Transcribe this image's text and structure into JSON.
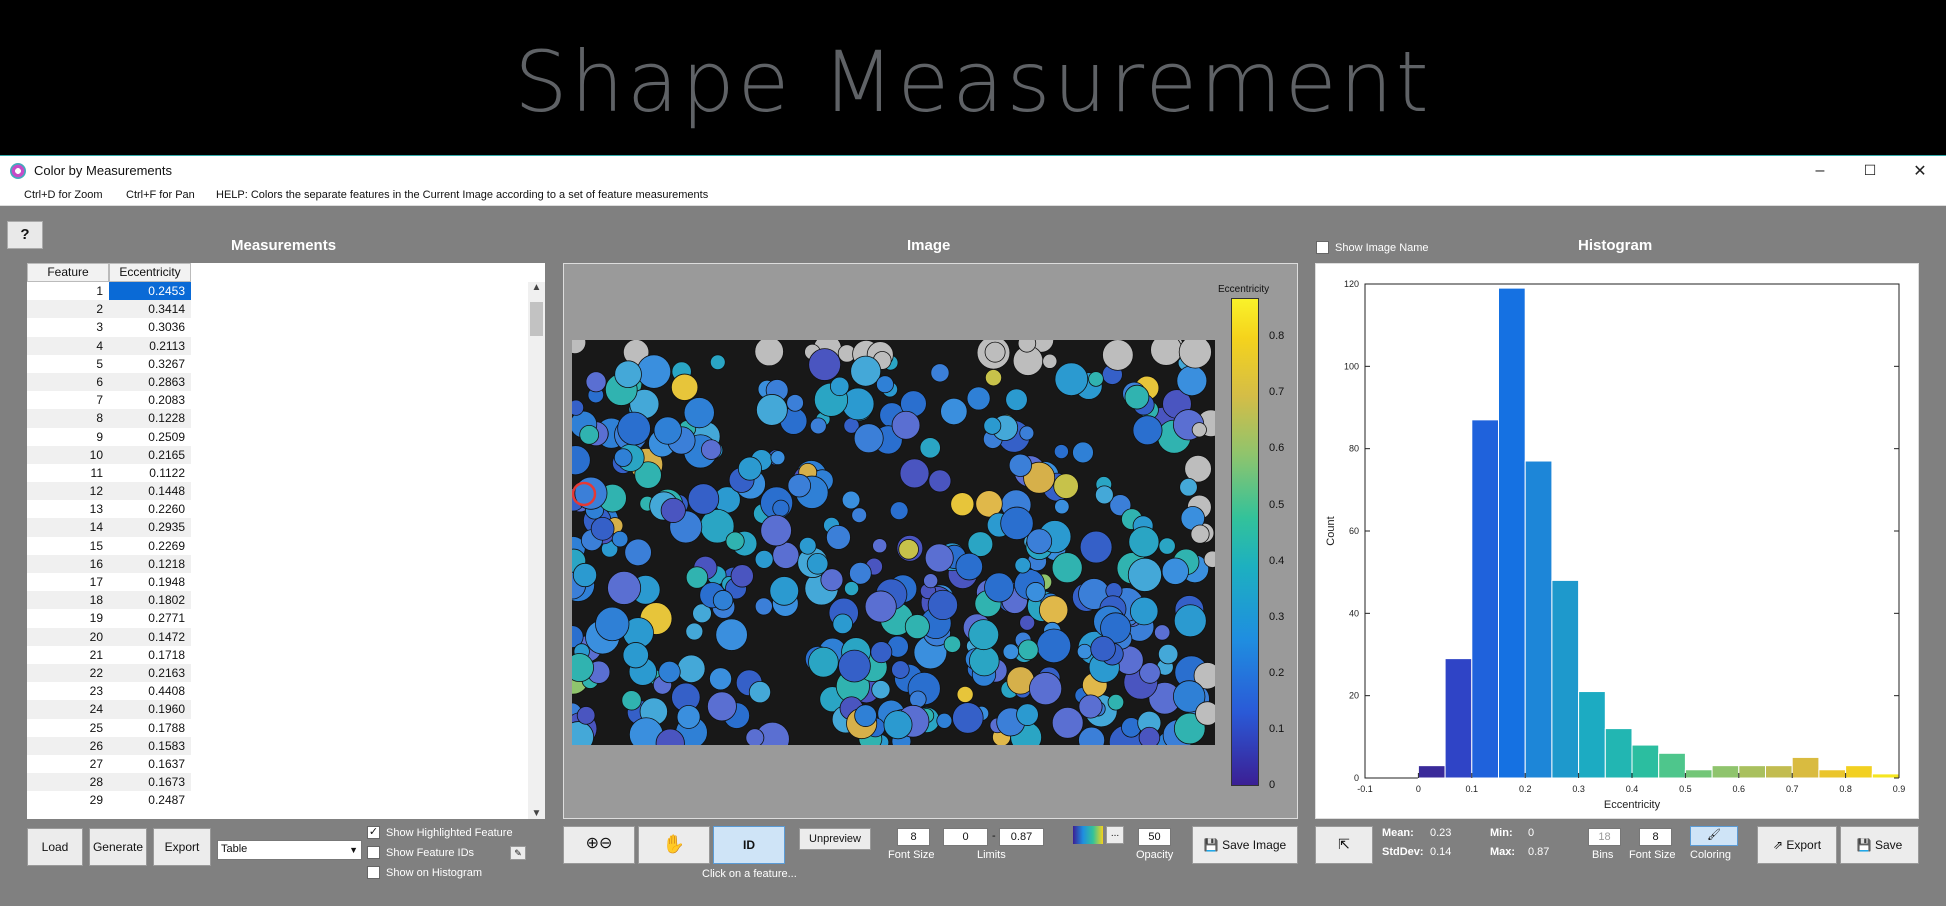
{
  "banner": {
    "title": "Shape Measurement"
  },
  "window": {
    "title": "Color by Measurements",
    "controls": {
      "minimize": "–",
      "maximize": "☐",
      "close": "✕"
    }
  },
  "menu": {
    "zoom": "Ctrl+D for Zoom",
    "pan": "Ctrl+F for Pan",
    "help": "HELP:  Colors the separate features in the Current Image according to a set of feature measurements"
  },
  "help_button": "?",
  "measurements": {
    "title": "Measurements",
    "columns": [
      "Feature",
      "Eccentricity"
    ],
    "rows": [
      [
        "1",
        "0.2453"
      ],
      [
        "2",
        "0.3414"
      ],
      [
        "3",
        "0.3036"
      ],
      [
        "4",
        "0.2113"
      ],
      [
        "5",
        "0.3267"
      ],
      [
        "6",
        "0.2863"
      ],
      [
        "7",
        "0.2083"
      ],
      [
        "8",
        "0.1228"
      ],
      [
        "9",
        "0.2509"
      ],
      [
        "10",
        "0.2165"
      ],
      [
        "11",
        "0.1122"
      ],
      [
        "12",
        "0.1448"
      ],
      [
        "13",
        "0.2260"
      ],
      [
        "14",
        "0.2935"
      ],
      [
        "15",
        "0.2269"
      ],
      [
        "16",
        "0.1218"
      ],
      [
        "17",
        "0.1948"
      ],
      [
        "18",
        "0.1802"
      ],
      [
        "19",
        "0.2771"
      ],
      [
        "20",
        "0.1472"
      ],
      [
        "21",
        "0.1718"
      ],
      [
        "22",
        "0.2163"
      ],
      [
        "23",
        "0.4408"
      ],
      [
        "24",
        "0.1960"
      ],
      [
        "25",
        "0.1788"
      ],
      [
        "26",
        "0.1583"
      ],
      [
        "27",
        "0.1637"
      ],
      [
        "28",
        "0.1673"
      ],
      [
        "29",
        "0.2487"
      ]
    ],
    "buttons": {
      "load": "Load",
      "generate": "Generate",
      "export": "Export"
    },
    "format_select": "Table",
    "checkboxes": {
      "highlighted": "Show Highlighted Feature",
      "feature_ids": "Show Feature IDs",
      "on_histogram": "Show on Histogram"
    }
  },
  "image": {
    "title": "Image",
    "colorbar_title": "Eccentricity",
    "colorbar_ticks": [
      "0.8",
      "0.7",
      "0.6",
      "0.5",
      "0.4",
      "0.3",
      "0.2",
      "0.1",
      "0"
    ],
    "controls": {
      "unpreview": "Unpreview",
      "id": "ID",
      "font_size_value": "8",
      "font_size_label": "Font Size",
      "limit_low": "0",
      "limit_sep": "-",
      "limit_high": "0.87",
      "limits_label": "Limits",
      "cmap_more": "...",
      "opacity_value": "50",
      "opacity_label": "Opacity",
      "save_image": "Save Image",
      "hint": "Click on a feature..."
    }
  },
  "histogram": {
    "title": "Histogram",
    "show_image_name": "Show Image Name",
    "stats": {
      "mean_label": "Mean:",
      "mean": "0.23",
      "min_label": "Min:",
      "min": "0",
      "std_label": "StdDev:",
      "std": "0.14",
      "max_label": "Max:",
      "max": "0.87"
    },
    "controls": {
      "bins_value": "18",
      "bins_label": "Bins",
      "font_value": "8",
      "font_label": "Font Size",
      "coloring_label": "Coloring",
      "export": "Export",
      "save": "Save"
    }
  },
  "chart_data": {
    "type": "bar",
    "xlabel": "Eccentricity",
    "ylabel": "Count",
    "xlim": [
      -0.1,
      0.9
    ],
    "ylim": [
      0,
      120
    ],
    "xticks": [
      "-0.1",
      "0",
      "0.1",
      "0.2",
      "0.3",
      "0.4",
      "0.5",
      "0.6",
      "0.7",
      "0.8",
      "0.9"
    ],
    "yticks": [
      "0",
      "20",
      "40",
      "60",
      "80",
      "100",
      "120"
    ],
    "bin_width": 0.05,
    "bin_starts": [
      0,
      0.05,
      0.1,
      0.15,
      0.2,
      0.25,
      0.3,
      0.35,
      0.4,
      0.45,
      0.5,
      0.55,
      0.6,
      0.65,
      0.7,
      0.75,
      0.8,
      0.85
    ],
    "values": [
      3,
      29,
      87,
      119,
      77,
      48,
      21,
      12,
      8,
      6,
      2,
      3,
      3,
      3,
      5,
      2,
      3,
      1
    ],
    "colors": [
      "#3a2a9a",
      "#2f44c6",
      "#1f62dc",
      "#1571e2",
      "#1d86d8",
      "#1e99cc",
      "#1cabc2",
      "#22b6b2",
      "#2bbea0",
      "#4ec68c",
      "#73c678",
      "#8fc46d",
      "#a9c05e",
      "#c2bc50",
      "#d9bb40",
      "#eac52c",
      "#f2d021",
      "#f5e620"
    ]
  }
}
